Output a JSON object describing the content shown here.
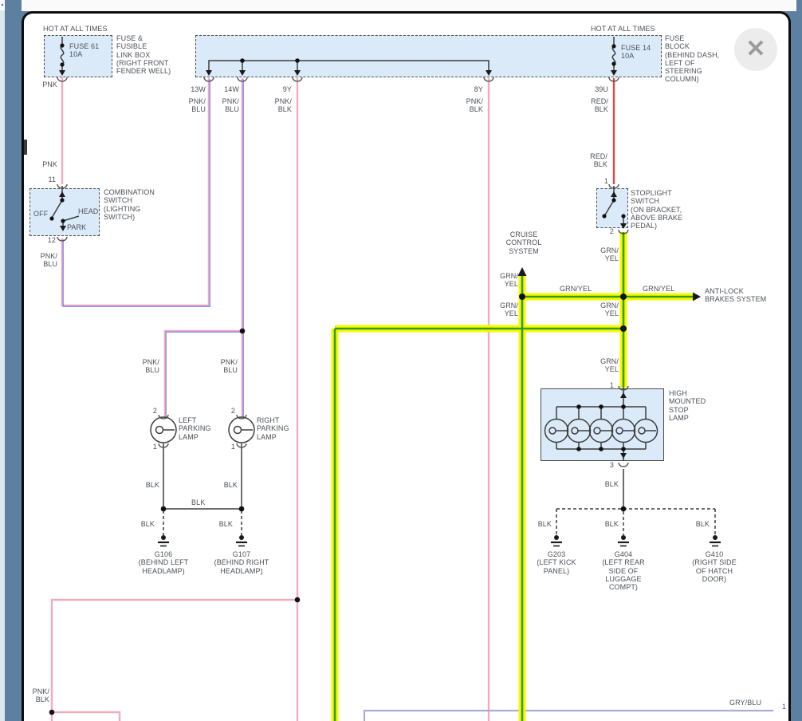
{
  "colors": {
    "background": "#5d80a1",
    "box_fill": "#dbeaf8",
    "box_border": "#4d4d4d",
    "text": "#4c5058",
    "wire_pnk": "#f2abbe",
    "wire_blu_stripe": "#8186e8",
    "wire_red": "#e04a4a",
    "wire_blk": "#3d3d3d",
    "wire_yel": "#f8f800",
    "wire_grn": "#2fa01c",
    "wire_gryblu": "#a9aed8",
    "close_bg": "#ececec",
    "close_x": "#9b9b9b"
  },
  "window": {
    "close_glyph": "✕",
    "scroll_up_glyph": "▲"
  },
  "diagram": {
    "left_power": {
      "hot": "HOT AT ALL TIMES",
      "fuse": "FUSE 61\n10A",
      "box": "FUSE &\nFUSIBLE\nLINK BOX\n(RIGHT FRONT\nFENDER WELL)",
      "wire_top": "PNK",
      "wire_mid": "PNK",
      "term_in": "11",
      "term_out": "12",
      "pos_off": "OFF",
      "pos_head": "HEAD",
      "pos_park": "PARK",
      "switch": "COMBINATION\nSWITCH\n(LIGHTING\nSWITCH)",
      "wire_out": "PNK/\nBLU"
    },
    "fuse_block": {
      "hot": "HOT AT ALL TIMES",
      "fuse": "FUSE 14\n10A",
      "box": "FUSE\nBLOCK\n(BEHIND DASH,\nLEFT OF\nSTEERING\nCOLUMN)",
      "t13w": "13W",
      "t13w_color": "PNK/\nBLU",
      "t14w": "14W",
      "t14w_color": "PNK/\nBLU",
      "t9y": "9Y",
      "t9y_color": "PNK/\nBLK",
      "t8y": "8Y",
      "t8y_color": "PNK/\nBLK",
      "t39u": "39U",
      "t39u_color": "RED/\nBLK"
    },
    "stoplight": {
      "wire_in": "RED/\nBLK",
      "term_in": "1",
      "label": "STOPLIGHT\nSWITCH\n(ON BRACKET,\nABOVE BRAKE\nPEDAL)",
      "term_out": "2",
      "wire_out": "GRN/\nYEL"
    },
    "brake": {
      "cruise": "CRUISE\nCONTROL\nSYSTEM",
      "cruise_wire": "GRN/\nYEL",
      "seg1": "GRN/YEL",
      "seg2": "GRN/YEL",
      "antilock": "ANTI-LOCK\nBRAKES SYSTEM",
      "below_cruise": "GRN/\nYEL",
      "below_switch": "GRN/\nYEL",
      "lamp_wire": "GRN/\nYEL"
    },
    "hmsl": {
      "term_in": "1",
      "label": "HIGH\nMOUNTED\nSTOP\nLAMP",
      "term_out": "3",
      "wire_out": "BLK"
    },
    "parking": {
      "left_wire_in": "PNK/\nBLU",
      "right_wire_in": "PNK/\nBLU",
      "left_term_in": "2",
      "right_term_in": "2",
      "left_label": "LEFT\nPARKING\nLAMP",
      "right_label": "RIGHT\nPARKING\nLAMP",
      "left_term_out": "1",
      "right_term_out": "1",
      "left_wire_out": "BLK",
      "right_wire_out": "BLK",
      "bus_wire": "BLK"
    },
    "grounds_left": {
      "g106_wire": "BLK",
      "g107_wire": "BLK",
      "g106": "G106\n(BEHIND LEFT\nHEADLAMP)",
      "g107": "G107\n(BEHIND RIGHT\nHEADLAMP)"
    },
    "grounds_right": {
      "g203_wire": "BLK",
      "g404_wire": "BLK",
      "g410_wire": "BLK",
      "g203": "G203\n(LEFT KICK\nPANEL)",
      "g404": "G404\n(LEFT REAR\nSIDE OF\nLUGGAGE\nCOMPT)",
      "g410": "G410\n(RIGHT SIDE\nOF HATCH\nDOOR)"
    },
    "bottom": {
      "pnk_blk": "PNK/\nBLK",
      "gry_blu": "GRY/BLU",
      "term": "1"
    }
  }
}
